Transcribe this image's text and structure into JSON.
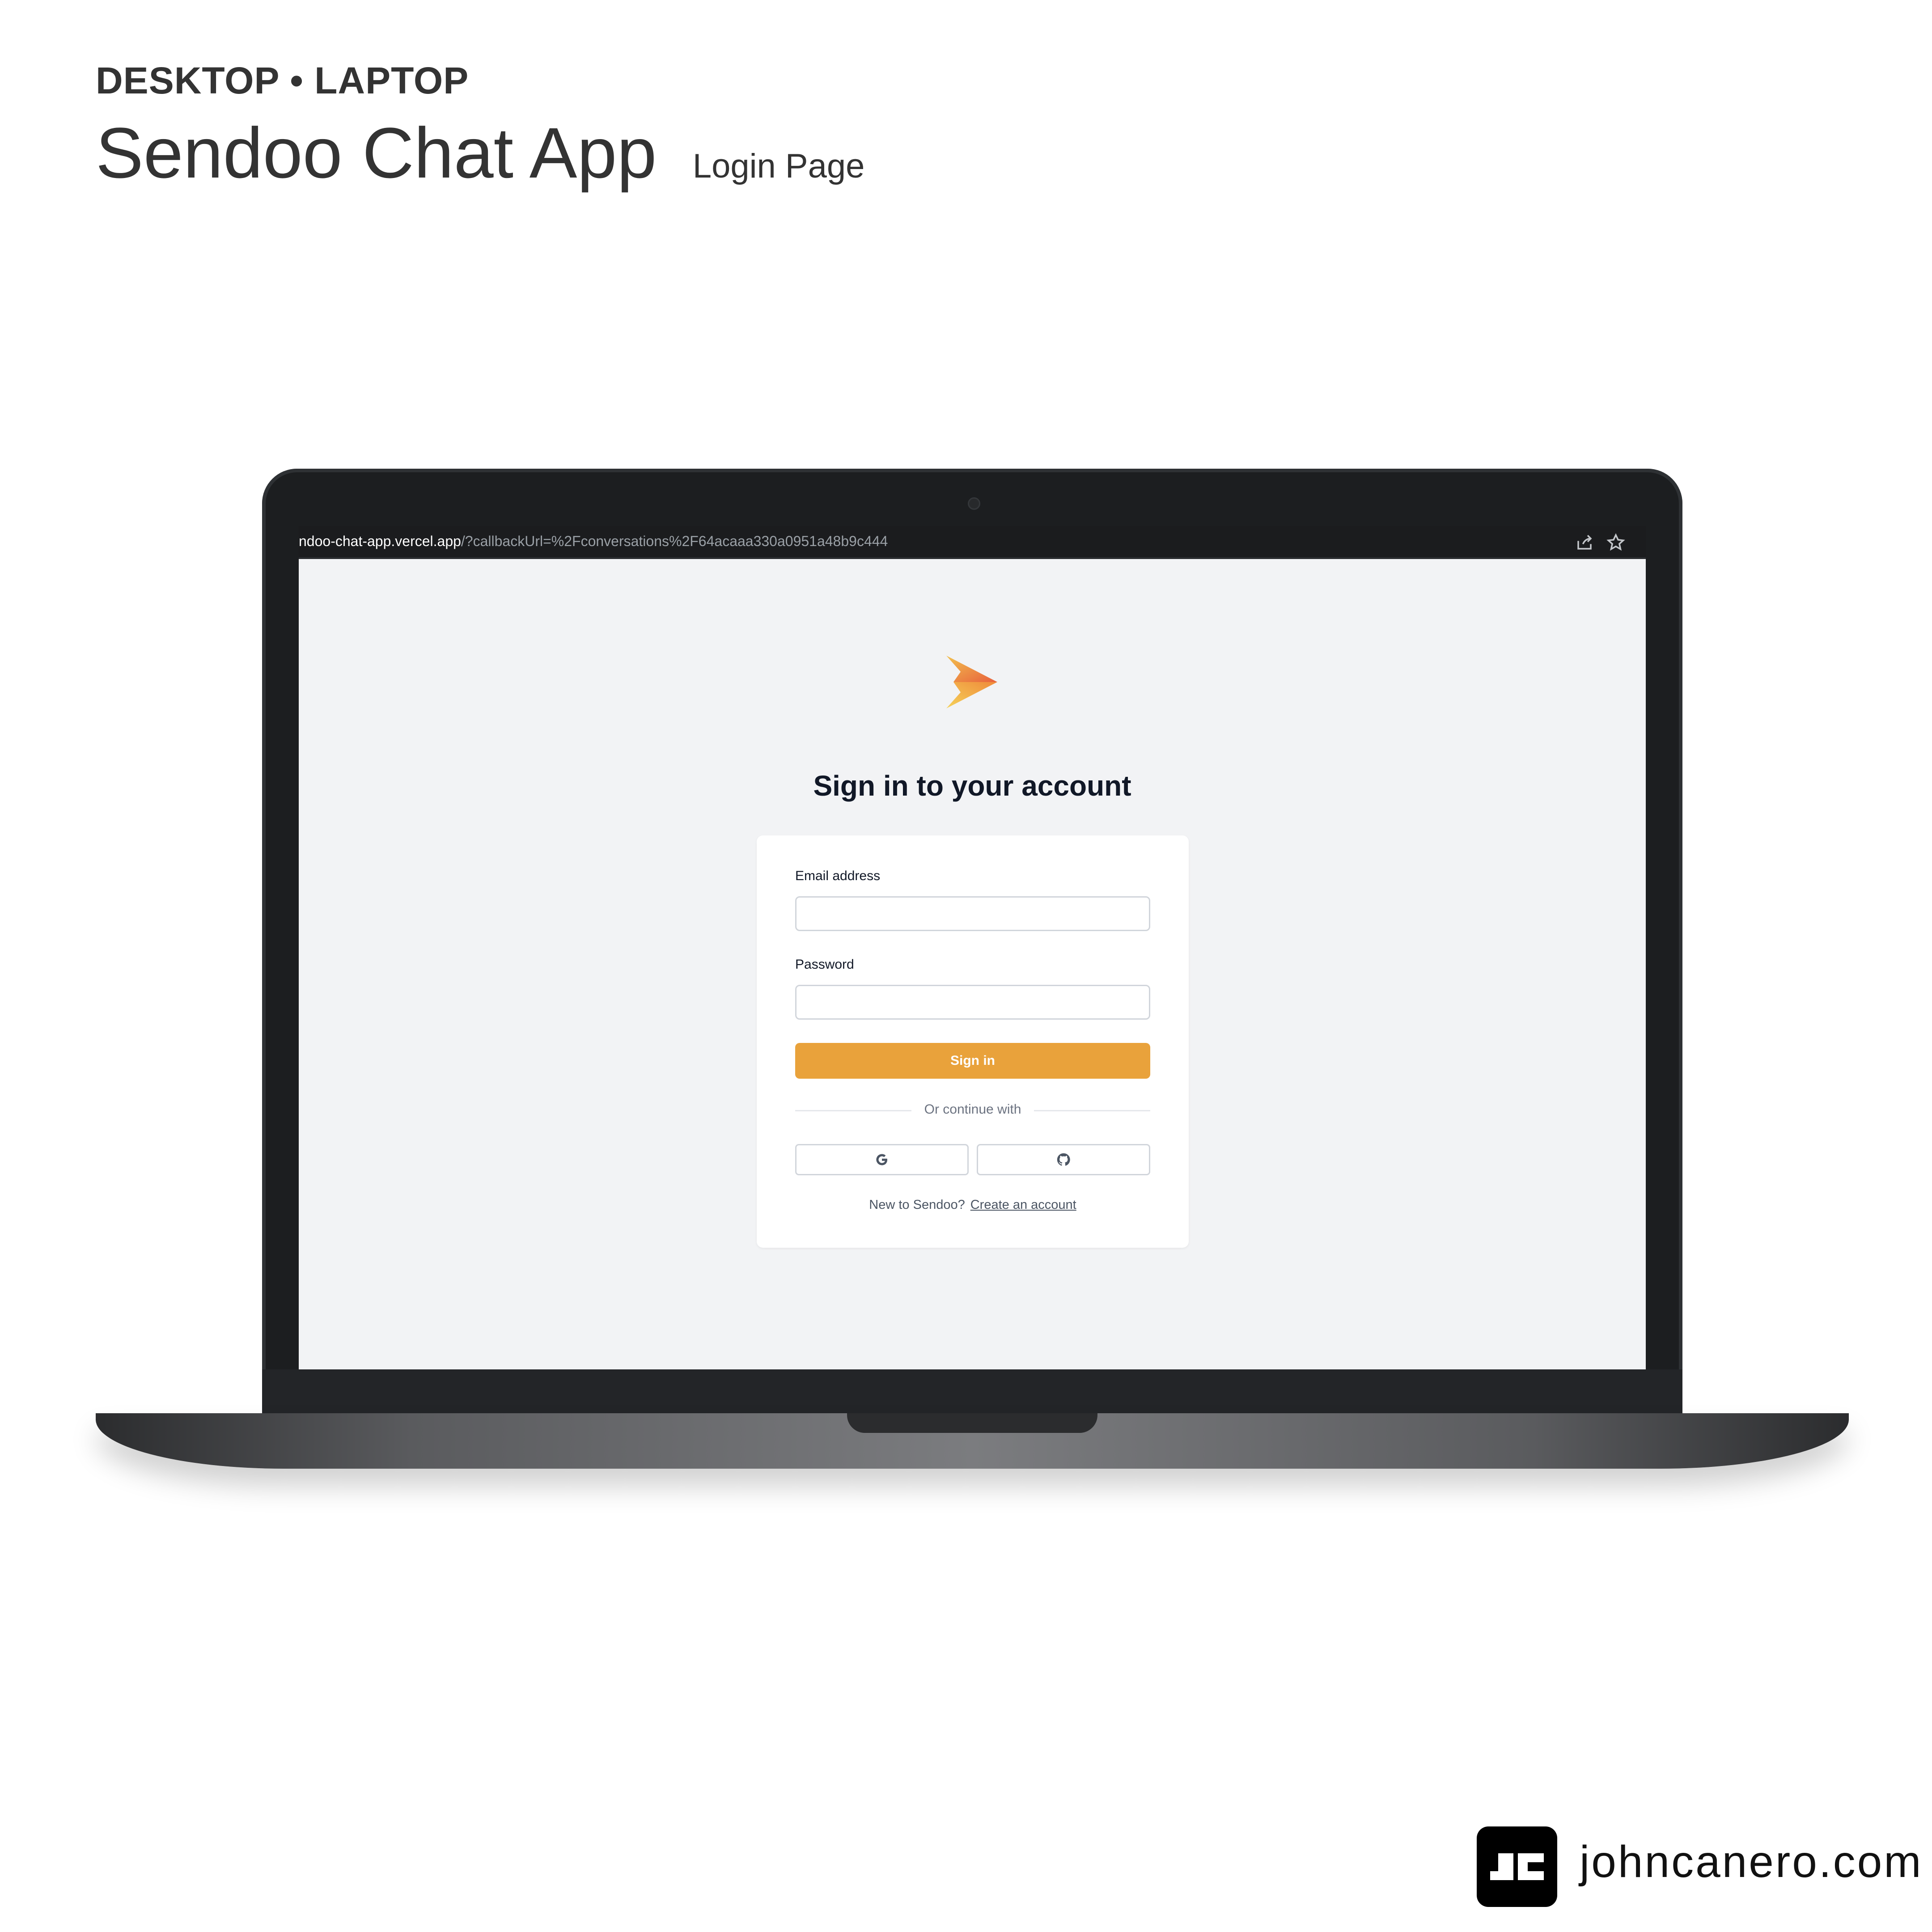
{
  "presentation": {
    "kicker": "DESKTOP • LAPTOP",
    "title": "Sendoo Chat App",
    "subtitle": "Login Page",
    "brand": "johncanero.com"
  },
  "browser": {
    "url_host": "ndoo-chat-app.vercel.app",
    "url_path": "/?callbackUrl=%2Fconversations%2F64acaaa330a0951a48b9c444",
    "icons": [
      "share-icon",
      "star-icon"
    ]
  },
  "login": {
    "heading": "Sign in to your account",
    "email_label": "Email address",
    "email_value": "",
    "password_label": "Password",
    "password_value": "",
    "submit_label": "Sign in",
    "divider_text": "Or continue with",
    "social_providers": [
      "google-icon",
      "github-icon"
    ],
    "footer_prompt": "New to Sendoo?",
    "footer_link": "Create an account"
  },
  "colors": {
    "accent": "#e9a23b",
    "page_bg": "#f2f3f5",
    "heading": "#111827"
  }
}
